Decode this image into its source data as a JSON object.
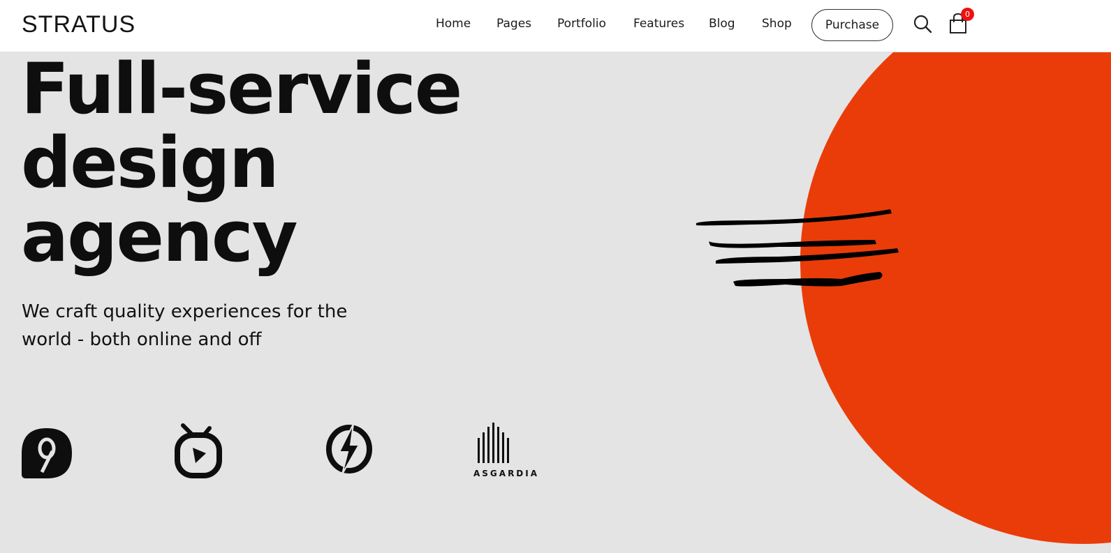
{
  "header": {
    "logo": "STRATUS",
    "nav": [
      {
        "label": "Home"
      },
      {
        "label": "Pages"
      },
      {
        "label": "Portfolio"
      },
      {
        "label": "Features"
      },
      {
        "label": "Blog"
      },
      {
        "label": "Shop"
      }
    ],
    "purchase_label": "Purchase",
    "search_icon": "search-icon",
    "cart_icon": "shopping-bag-icon",
    "cart_count": "0"
  },
  "hero": {
    "title": "Full-service\ndesign\nagency",
    "subtitle": "We craft quality experiences for the world - both online and off",
    "accent_color": "#ea3c09",
    "background_color": "#e4e4e4"
  },
  "clients": [
    {
      "name": "nine-logo",
      "icon": "nine-icon"
    },
    {
      "name": "tv-play-logo",
      "icon": "tv-play-icon"
    },
    {
      "name": "lightning-logo",
      "icon": "lightning-icon"
    },
    {
      "name": "asgardia-logo",
      "icon": "asgardia-bars-icon",
      "label": "ASGARDIA"
    }
  ],
  "colors": {
    "accent": "#ea3c09",
    "badge": "#ee1111",
    "text": "#111111",
    "header_bg": "#ffffff"
  }
}
